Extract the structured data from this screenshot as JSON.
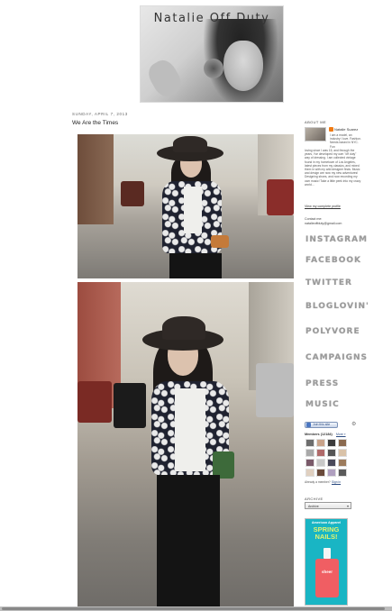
{
  "blog": {
    "title": "Natalie Off Duty"
  },
  "post": {
    "date": "SUNDAY, APRIL 7, 2013",
    "title": "We Are the Times"
  },
  "sidebar": {
    "about_heading": "ABOUT ME",
    "profile_name": "Natalie Suarez",
    "about_text": "I am a model, an industry I love. Fashion. Needs based in NYC. Fun",
    "about_text2": "loving since I was 15, and through the years, I've developed my own \"off duty\" way of dressing. I am collected vintage found in my hometown of Los Angeles, latest pieces from my classics, and mixed them in with my wild designer finds. Music and design are now my new adventures! Designing shoes, and now recording my own music! Take a little peek into my crazy world...",
    "profile_link": "View my complete profile",
    "contact_label": "Contact me:",
    "contact_email": "natalieoffduty@gmail.com",
    "social_links": [
      "INSTAGRAM",
      "FACEBOOK",
      "TWITTER",
      "BLOGLOVIN'",
      "POLYVORE",
      "CAMPAIGNS",
      "PRESS",
      "MUSIC"
    ],
    "join_button": "Join this site",
    "members_label": "Members (12184)",
    "members_more": "More »",
    "already_member": "Already a member?",
    "sign_in": "Sign in",
    "archive_heading": "ARCHIVE",
    "archive_select": "Archive",
    "ad_brand": "American Apparel",
    "ad_headline": "SPRING NAILS!",
    "ad_bottle_label": "sheer"
  },
  "colors": {
    "accent": "#f07b14",
    "ad_background": "#19b5c4",
    "ad_headline": "#e4f36c",
    "ad_bottle": "#f05e63"
  }
}
